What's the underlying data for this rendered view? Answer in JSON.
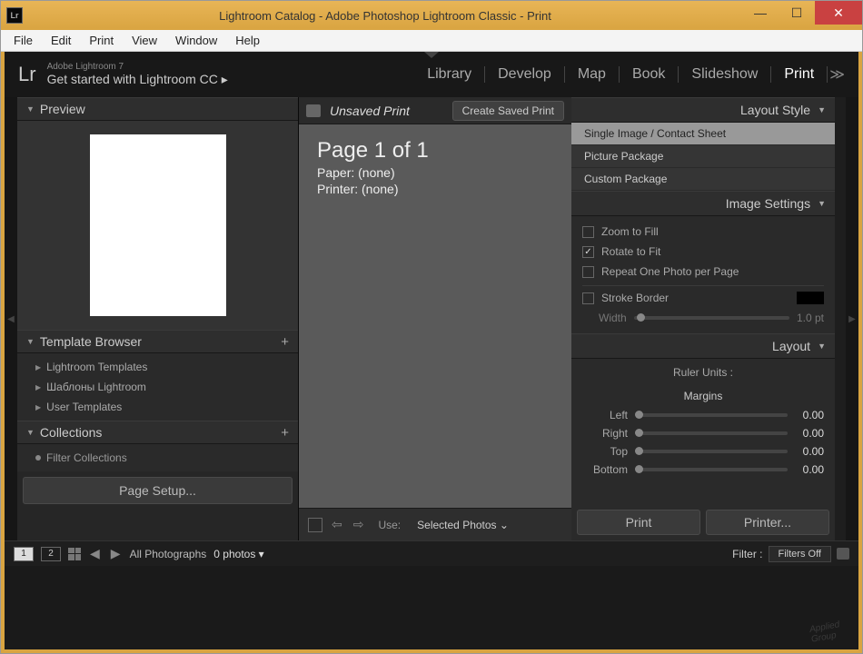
{
  "window": {
    "title": "Lightroom Catalog - Adobe Photoshop Lightroom Classic - Print",
    "icon": "Lr"
  },
  "menubar": [
    "File",
    "Edit",
    "Print",
    "View",
    "Window",
    "Help"
  ],
  "header": {
    "logo": "Lr",
    "tagline1": "Adobe Lightroom 7",
    "tagline2": "Get started with Lightroom CC ▸"
  },
  "modules": [
    "Library",
    "Develop",
    "Map",
    "Book",
    "Slideshow",
    "Print"
  ],
  "active_module": "Print",
  "left": {
    "preview": "Preview",
    "template_browser": "Template Browser",
    "templates": [
      "Lightroom Templates",
      "Шаблоны Lightroom",
      "User Templates"
    ],
    "collections": "Collections",
    "filter_collections": "Filter Collections",
    "page_setup": "Page Setup..."
  },
  "center": {
    "unsaved": "Unsaved Print",
    "create_saved": "Create Saved Print",
    "page_of": "Page 1 of 1",
    "paper": "Paper:  (none)",
    "printer": "Printer:  (none)",
    "use_label": "Use:",
    "use_value": "Selected Photos"
  },
  "right": {
    "layout_style": "Layout Style",
    "styles": [
      "Single Image / Contact Sheet",
      "Picture Package",
      "Custom Package"
    ],
    "selected_style": "Single Image / Contact Sheet",
    "image_settings": "Image Settings",
    "zoom_fill": "Zoom to Fill",
    "rotate_fit": "Rotate to Fit",
    "repeat": "Repeat One Photo per Page",
    "stroke": "Stroke Border",
    "width_label": "Width",
    "width_val": "1.0 pt",
    "layout": "Layout",
    "ruler_units": "Ruler Units :",
    "margins": "Margins",
    "margin_rows": [
      {
        "label": "Left",
        "val": "0.00"
      },
      {
        "label": "Right",
        "val": "0.00"
      },
      {
        "label": "Top",
        "val": "0.00"
      },
      {
        "label": "Bottom",
        "val": "0.00"
      }
    ],
    "print_btn": "Print",
    "printer_btn": "Printer..."
  },
  "footer": {
    "view1": "1",
    "view2": "2",
    "all_photos": "All Photographs",
    "count": "0 photos",
    "filter_label": "Filter :",
    "filter_value": "Filters Off"
  }
}
